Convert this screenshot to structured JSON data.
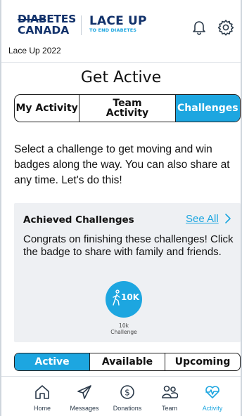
{
  "header": {
    "logo_left_top": "DIABETES",
    "logo_left_bottom": "CANADA",
    "logo_right_main": "LACE UP",
    "logo_right_sub": "TO END DIABETES",
    "event_label": "Lace Up 2022",
    "icons": [
      "bell-icon",
      "gear-icon"
    ]
  },
  "page": {
    "title": "Get Active"
  },
  "top_tabs": [
    {
      "label": "My Activity",
      "active": false
    },
    {
      "label": "Team Activity",
      "active": false
    },
    {
      "label": "Challenges",
      "active": true
    }
  ],
  "intro_text": "Select a challenge to get moving and win badges along the way. You can also share at any time. Let's do this!",
  "achieved": {
    "title": "Achieved Challenges",
    "see_all": "See All",
    "description": "Congrats on finishing these challenges! Click the badge to share with family and friends.",
    "badge": {
      "label": "10K",
      "caption_line1": "10k",
      "caption_line2": "Challenge"
    }
  },
  "filter_tabs": [
    {
      "label": "Active",
      "active": true
    },
    {
      "label": "Available",
      "active": false
    },
    {
      "label": "Upcoming",
      "active": false
    }
  ],
  "nav": [
    {
      "label": "Home",
      "icon": "home-icon",
      "active": false
    },
    {
      "label": "Messages",
      "icon": "paper-plane-icon",
      "active": false
    },
    {
      "label": "Donations",
      "icon": "dollar-icon",
      "active": false
    },
    {
      "label": "Team",
      "icon": "team-icon",
      "active": false
    },
    {
      "label": "Activity",
      "icon": "heart-pulse-icon",
      "active": true
    }
  ],
  "colors": {
    "accent": "#1da6e0",
    "brand_navy": "#12326b",
    "card_bg": "#eef0f3"
  }
}
